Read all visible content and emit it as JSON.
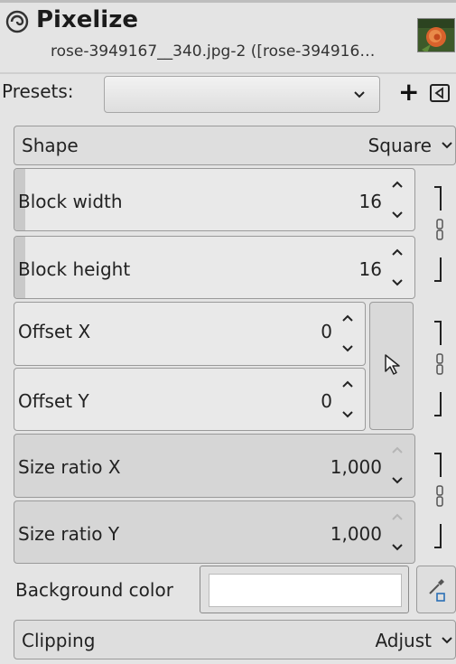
{
  "header": {
    "title": "Pixelize",
    "subtitle": "rose-3949167__340.jpg-2 ([rose-394916…"
  },
  "presets": {
    "label": "Presets:",
    "value": "",
    "add_label": "+"
  },
  "shape": {
    "label": "Shape",
    "value": "Square"
  },
  "block_width": {
    "label": "Block width",
    "value": "16"
  },
  "block_height": {
    "label": "Block height",
    "value": "16"
  },
  "offset_x": {
    "label": "Offset X",
    "value": "0"
  },
  "offset_y": {
    "label": "Offset Y",
    "value": "0"
  },
  "size_ratio_x": {
    "label": "Size ratio X",
    "value": "1,000"
  },
  "size_ratio_y": {
    "label": "Size ratio Y",
    "value": "1,000"
  },
  "background_color": {
    "label": "Background color",
    "value": "#ffffff"
  },
  "clipping": {
    "label": "Clipping",
    "value": "Adjust"
  },
  "icons": {
    "filter": "gegl-filter-icon",
    "dropdown": "chevron-down-icon",
    "add": "plus-icon",
    "menu": "triangle-left-icon",
    "chain": "chain-link-icon",
    "pointer": "cursor-pointer-icon",
    "picker": "color-picker-icon"
  },
  "colors": {
    "background": "#e4e4e4",
    "swatch": "#ffffff"
  }
}
